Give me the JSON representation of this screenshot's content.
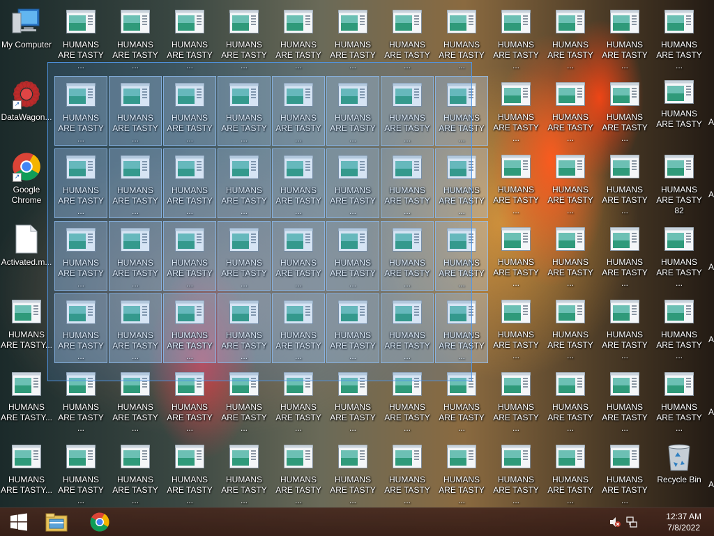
{
  "desktop": {
    "my_computer": "My Computer",
    "datawagon": "DataWagon...",
    "chrome": "Google Chrome",
    "activated": "Activated.m...",
    "recycle_bin": "Recycle Bin",
    "tasty_truncated": "HUMANS ARE TASTY ...",
    "tasty_truncated_tight": "HUMANS ARE TASTY...",
    "tasty_full": "HUMANS ARE TASTY",
    "tasty_number": "HUMANS ARE TASTY 82",
    "partial_letter": "A"
  },
  "taskbar": {
    "time": "12:37 AM",
    "date": "7/8/2022"
  },
  "icons": {
    "file_icon": "app-window-icon",
    "computer": "computer-icon",
    "datawagon": "datawagon-icon",
    "chrome": "chrome-icon",
    "document": "document-icon",
    "recycle": "recycle-bin-icon",
    "start": "windows-start-icon",
    "explorer": "file-explorer-icon",
    "volume": "speaker-muted-icon",
    "network": "network-icon"
  },
  "colors": {
    "selection": "#5096e6",
    "taskbar": "#46281e"
  }
}
